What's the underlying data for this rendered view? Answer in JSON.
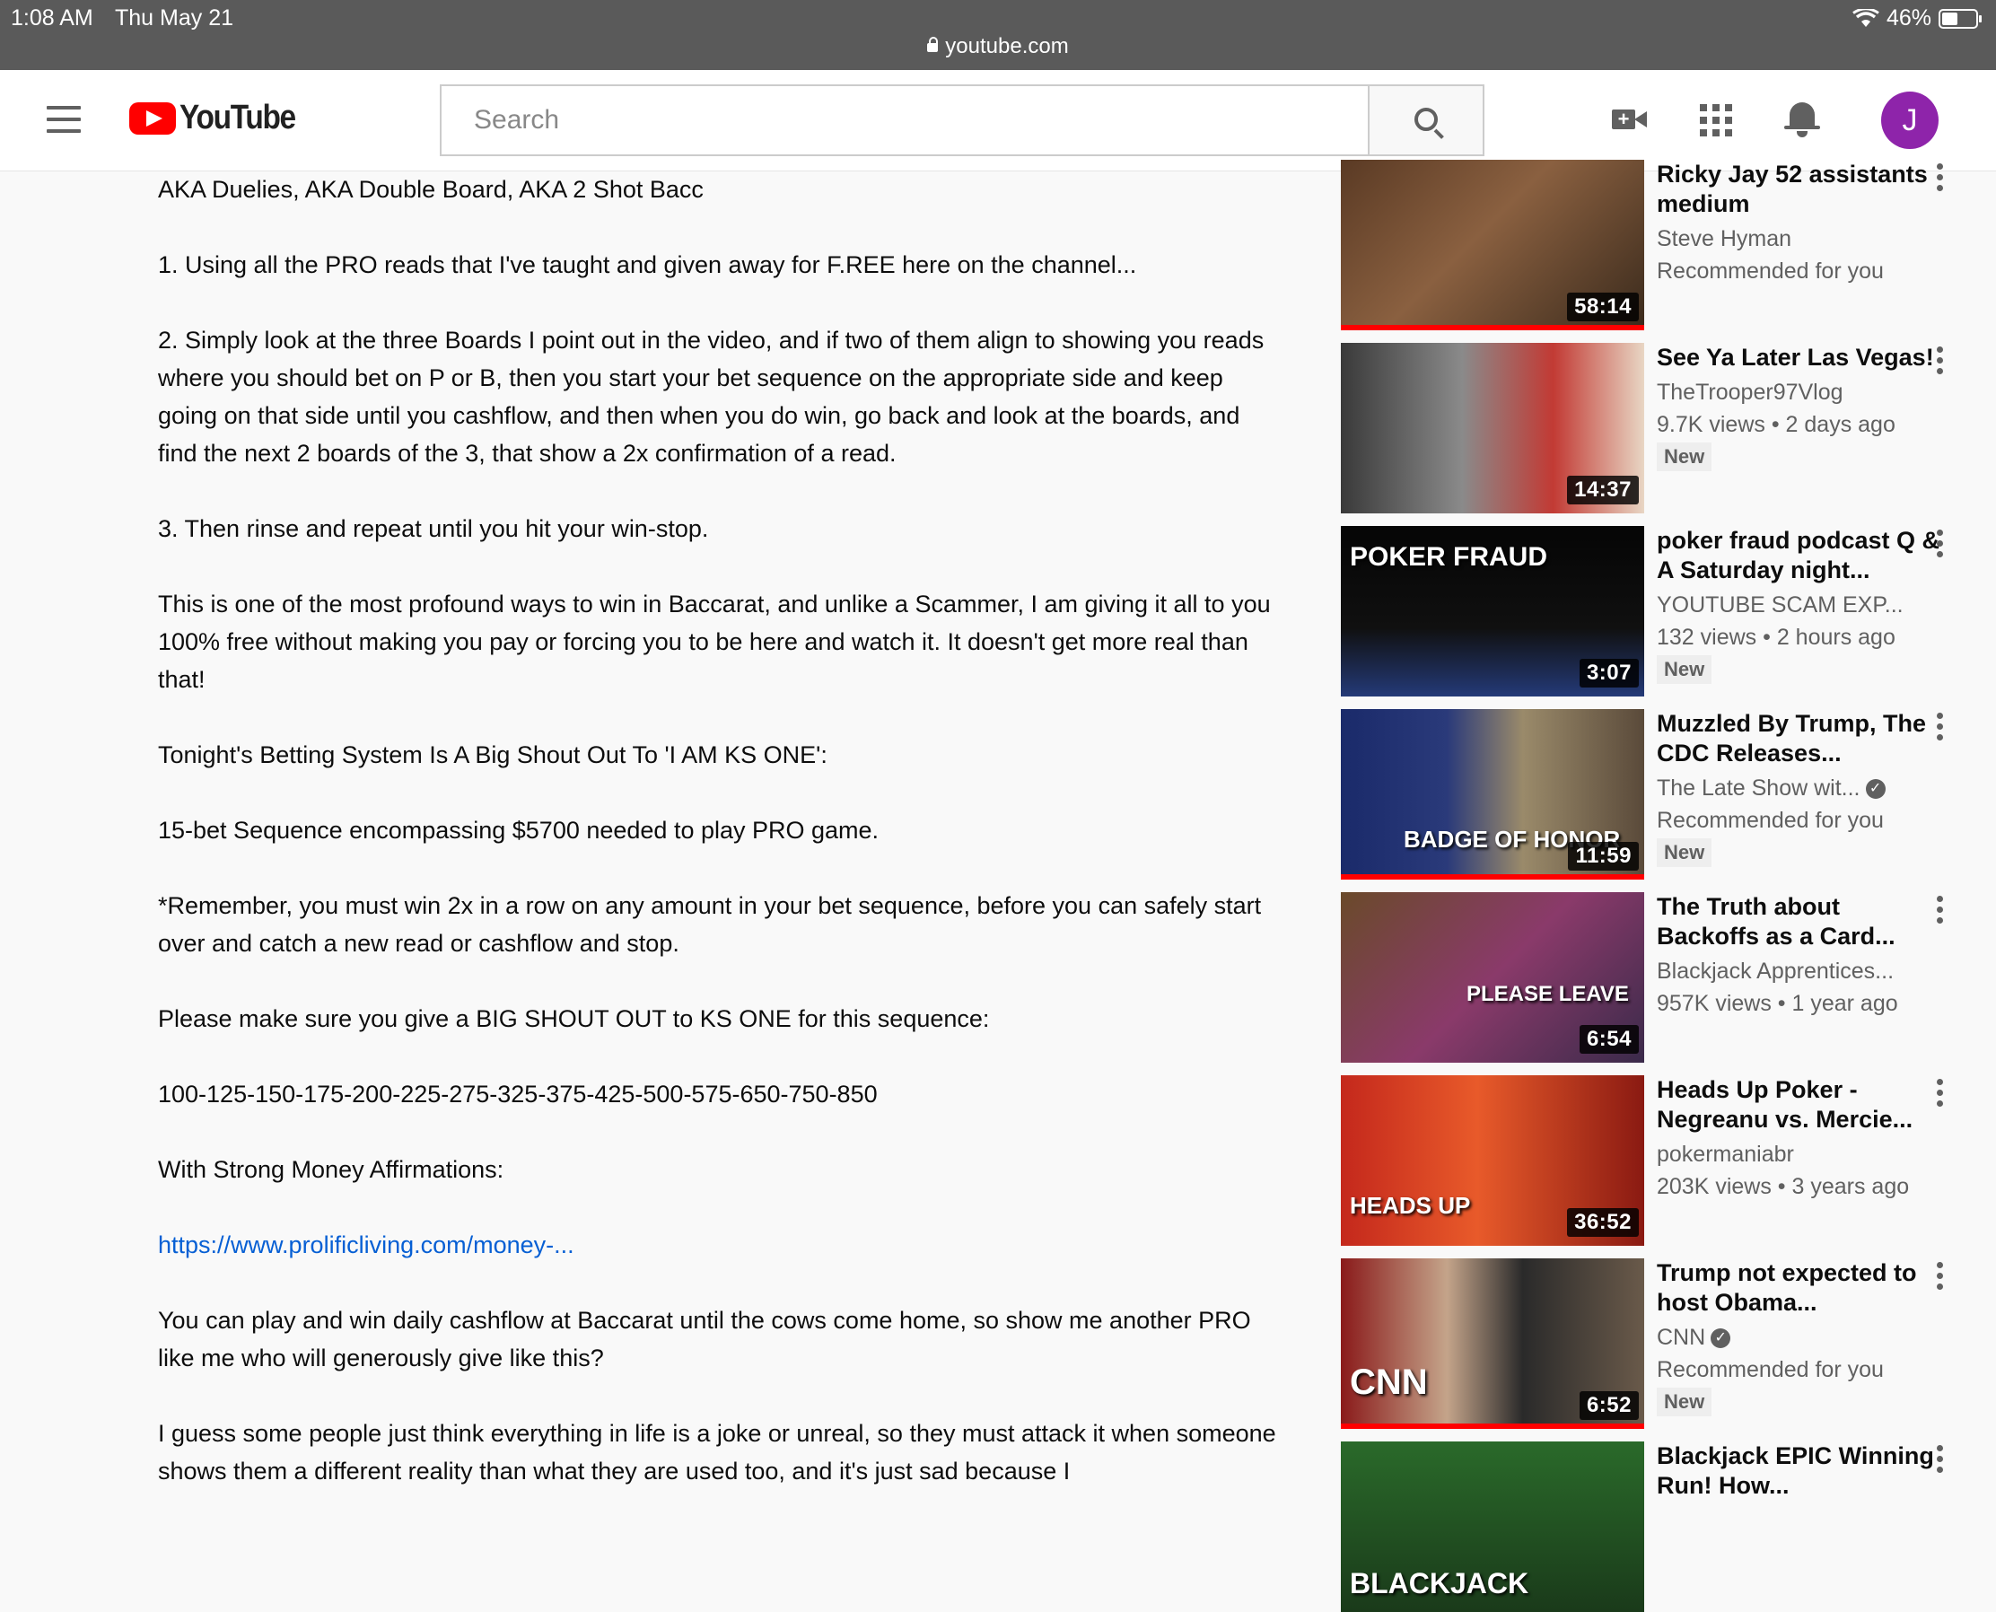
{
  "status_bar": {
    "time": "1:08 AM",
    "date": "Thu May 21",
    "url": "youtube.com",
    "battery": "46%",
    "battery_level": 0.46
  },
  "masthead": {
    "logo_text": "YouTube",
    "search_placeholder": "Search",
    "avatar_initial": "J"
  },
  "description": {
    "paragraphs": [
      "AKA Duelies, AKA Double Board, AKA 2 Shot Bacc",
      "1. Using all the PRO reads that I've taught and given away for F.REE here on the channel...",
      "2. Simply look at the three Boards I point out in the video, and if two of them align to showing you reads where you should bet on P or B, then you start your bet sequence on the appropriate side and keep going on that side until you cashflow, and then when you do win, go back and look at the boards, and find the next 2 boards of the 3, that show a 2x confirmation of a read.",
      "3. Then rinse and repeat until you hit your win-stop.",
      "This is one of the most profound ways to win in Baccarat, and unlike a Scammer, I am giving it all to you 100% free without making you pay or forcing you to be here and watch it. It doesn't get more real than that!",
      "Tonight's Betting System Is A Big Shout Out To 'I AM KS ONE':",
      "15-bet Sequence encompassing $5700 needed to play PRO game.",
      "*Remember, you must win 2x in a row on any amount in your bet sequence, before you can safely start over and catch a new read or cashflow and stop.",
      "Please make sure you give a BIG SHOUT OUT to KS ONE for this sequence:",
      "100-125-150-175-200-225-275-325-375-425-500-575-650-750-850",
      "With Strong Money Affirmations:"
    ],
    "link": "https://www.prolificliving.com/money-...",
    "paragraphs_after": [
      "You can play and win daily cashflow at Baccarat until the cows come home, so show me another PRO like me who will generously give like this?",
      "I guess some people just think everything in life is a joke or unreal, so they must attack it when someone shows them a different reality than what they are used too, and it's just sad because I"
    ]
  },
  "sidebar": {
    "videos": [
      {
        "title": "Ricky Jay 52 assistants medium",
        "channel": "Steve Hyman",
        "stats": "Recommended for you",
        "badge": "",
        "duration": "58:14",
        "verified": false,
        "watched": 1.0,
        "thumb_bg": "linear-gradient(135deg,#5a3a24 0%,#8a6040 45%,#3a2a1c 100%)",
        "overlay": ""
      },
      {
        "title": "See Ya Later Las Vegas!",
        "channel": "TheTrooper97Vlog",
        "stats": "9.7K views • 2 days ago",
        "badge": "New",
        "duration": "14:37",
        "verified": false,
        "watched": 0,
        "thumb_bg": "linear-gradient(90deg,#3a3a3a 0%,#8a8a8a 40%,#c23a34 70%,#e8d6c4 100%)",
        "overlay": ""
      },
      {
        "title": "poker fraud podcast Q & A Saturday night...",
        "channel": "YOUTUBE SCAM EXP...",
        "stats": "132 views • 2 hours ago",
        "badge": "New",
        "duration": "3:07",
        "verified": false,
        "watched": 0,
        "thumb_bg": "linear-gradient(180deg,#050505 0%,#101010 60%,#243a78 100%)",
        "overlay": "POKER FRAUD"
      },
      {
        "title": "Muzzled By Trump, The CDC Releases...",
        "channel": "The Late Show wit...",
        "stats": "Recommended for you",
        "badge": "New",
        "duration": "11:59",
        "verified": true,
        "watched": 1.0,
        "thumb_bg": "linear-gradient(90deg,#1a2a6a 0%,#2a3a7a 35%,#9a8a6a 60%,#5a4a3a 100%)",
        "overlay": "BADGE OF HONOR"
      },
      {
        "title": "The Truth about Backoffs as a Card...",
        "channel": "Blackjack Apprentices...",
        "stats": "957K views • 1 year ago",
        "badge": "",
        "duration": "6:54",
        "verified": false,
        "watched": 0,
        "thumb_bg": "linear-gradient(135deg,#6a4a2a 0%,#8a3a6a 50%,#3a2a4a 100%)",
        "overlay": "PLEASE LEAVE"
      },
      {
        "title": "Heads Up Poker - Negreanu vs. Mercie...",
        "channel": "pokermaniabr",
        "stats": "203K views • 3 years ago",
        "badge": "",
        "duration": "36:52",
        "verified": false,
        "watched": 0,
        "thumb_bg": "linear-gradient(90deg,#c4281c 0%,#e85a2a 45%,#8a1a12 100%)",
        "overlay": "HEADS UP"
      },
      {
        "title": "Trump not expected to host Obama...",
        "channel": "CNN",
        "stats": "Recommended for you",
        "badge": "New",
        "duration": "6:52",
        "verified": true,
        "watched": 1.0,
        "thumb_bg": "linear-gradient(90deg,#8a1a1a 0%,#c4a48a 35%,#2a2a2a 60%,#6a5a4a 100%)",
        "overlay": "CNN"
      },
      {
        "title": "Blackjack EPIC Winning Run! How...",
        "channel": "",
        "stats": "",
        "badge": "",
        "duration": "",
        "verified": false,
        "watched": 0,
        "thumb_bg": "linear-gradient(180deg,#2a6a2a 0%,#1a3a1a 100%)",
        "overlay": "BLACKJACK"
      }
    ]
  }
}
